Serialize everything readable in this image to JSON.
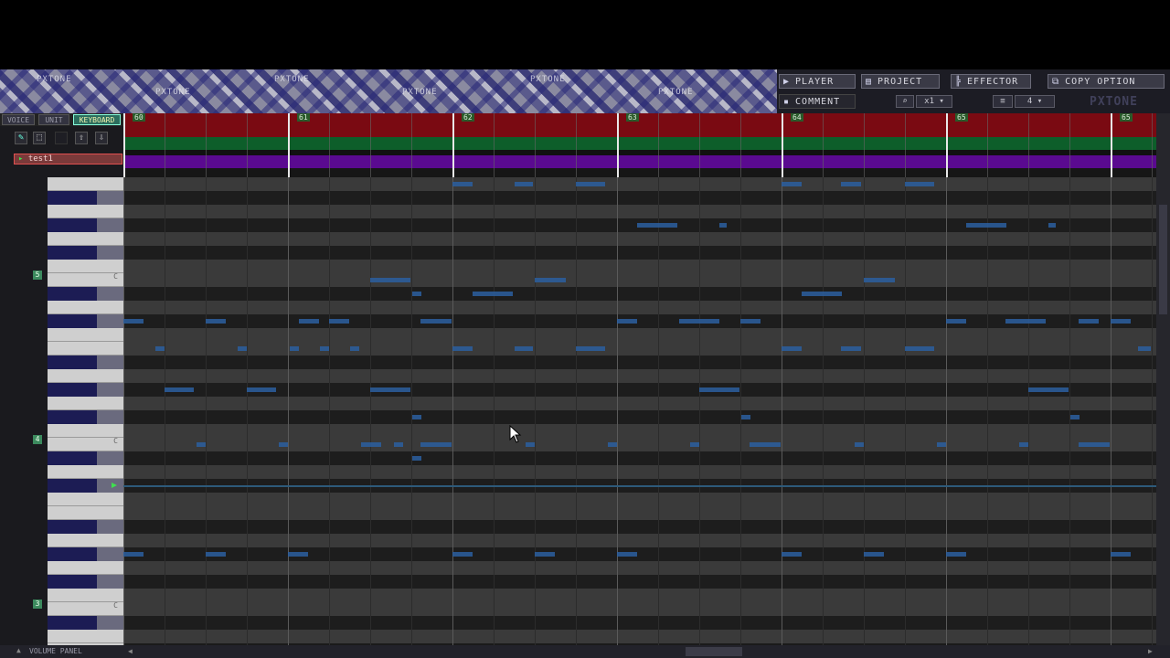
{
  "banner": {
    "word": "PXTONE"
  },
  "toolbar": {
    "player_label": "PLAYER",
    "project_label": "PROJECT",
    "effector_label": "EFFECTOR",
    "copy_option_label": "COPY OPTION",
    "comment_label": "COMMENT",
    "zoom_value": "x1",
    "division_value": "4",
    "logo": "PXTONE"
  },
  "tabs": {
    "voice": "VOICE",
    "unit": "UNIT",
    "keyboard": "KEYBOARD"
  },
  "unit": {
    "name": "test1"
  },
  "measures": [
    "60",
    "61",
    "62",
    "63",
    "64",
    "65"
  ],
  "octaves": [
    {
      "label": "5",
      "key": "C"
    },
    {
      "label": "4",
      "key": "C"
    },
    {
      "label": "3",
      "key": "C"
    }
  ],
  "volume_panel": "VOLUME PANEL",
  "colors": {
    "measure_bar": "#7a0a12",
    "green_row": "#0d5e2a",
    "unit_row": "#5a0a90",
    "note": "#2c5fa0"
  }
}
